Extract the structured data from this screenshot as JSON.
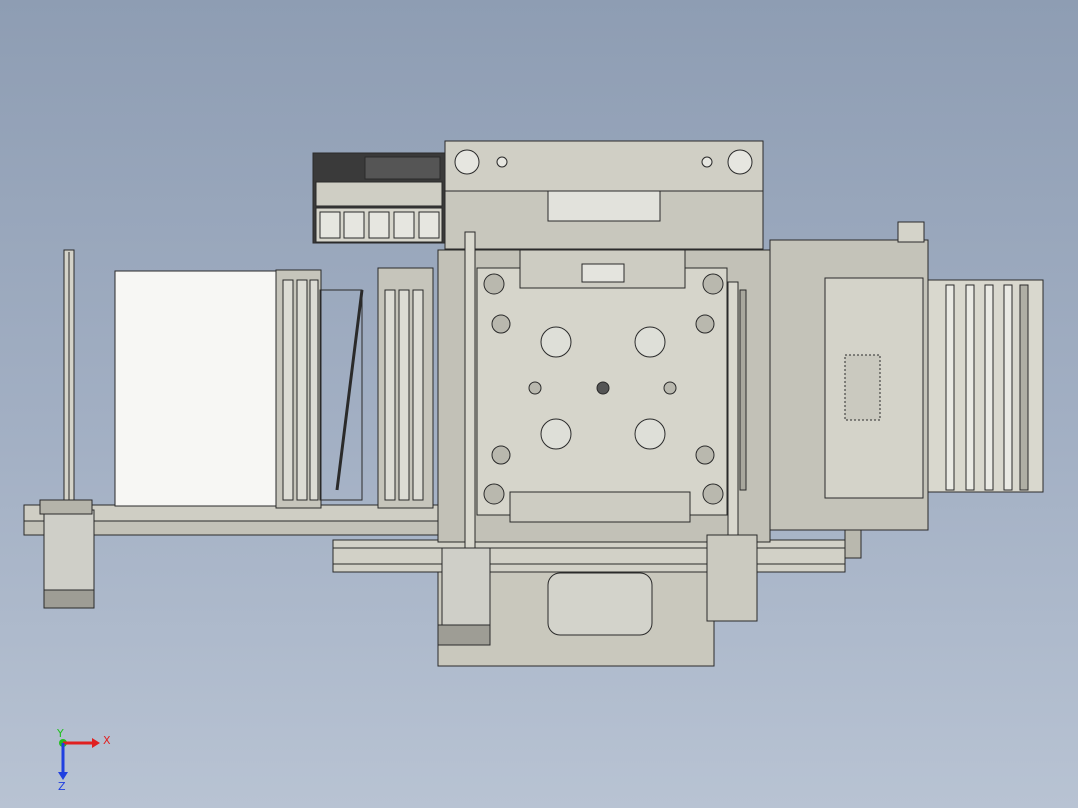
{
  "viewport": {
    "background_top": "#8e9db3",
    "background_bottom": "#b8c3d3",
    "part_fill": "#c9c8bd",
    "part_fill_light": "#d8d7cd",
    "part_stroke": "#2a2a2a",
    "roller_fill": "#dcdcd4"
  },
  "model": {
    "view": "top",
    "description_icon": "cad-machine-assembly"
  },
  "triad": {
    "x_label": "X",
    "y_label": "Y",
    "z_label": "Z",
    "x_color": "#e02020",
    "y_color": "#20c020",
    "z_color": "#2040e0"
  }
}
